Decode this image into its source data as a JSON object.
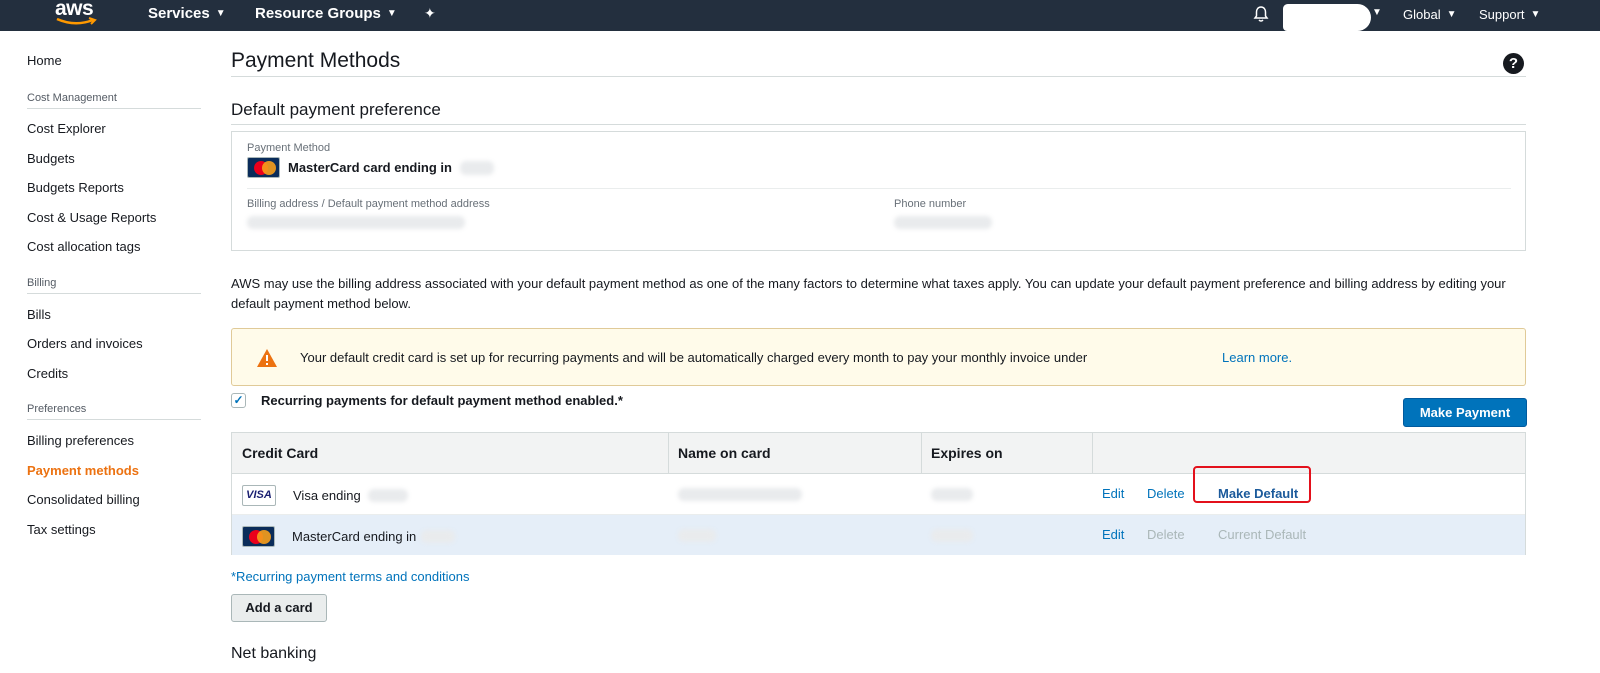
{
  "nav": {
    "logo": "aws",
    "services": "Services",
    "resource_groups": "Resource Groups",
    "region": "Global",
    "support": "Support"
  },
  "sidebar": {
    "home": "Home",
    "cost_management": {
      "heading": "Cost Management",
      "items": [
        "Cost Explorer",
        "Budgets",
        "Budgets Reports",
        "Cost & Usage Reports",
        "Cost allocation tags"
      ]
    },
    "billing": {
      "heading": "Billing",
      "items": [
        "Bills",
        "Orders and invoices",
        "Credits"
      ]
    },
    "preferences": {
      "heading": "Preferences",
      "items": [
        "Billing preferences",
        "Payment methods",
        "Consolidated billing",
        "Tax settings"
      ]
    },
    "active_item": "Payment methods"
  },
  "main": {
    "title": "Payment Methods",
    "default_section_title": "Default payment preference",
    "payment_method_label": "Payment Method",
    "payment_method_value": "MasterCard card ending in",
    "billing_address_label": "Billing address / Default payment method address",
    "phone_label": "Phone number",
    "tax_note": "AWS may use the billing address associated with your default payment method as one of the many factors to determine what taxes apply. You can update your default payment preference and billing address by editing your default payment method below.",
    "alert_text": "Your default credit card is set up for recurring payments and will be automatically charged every month to pay your monthly invoice under",
    "alert_link": "Learn more.",
    "recurring_label": "Recurring payments for default payment method enabled.*",
    "recurring_checked": true,
    "make_payment": "Make Payment",
    "terms_link": "*Recurring payment terms and conditions",
    "add_card": "Add a card",
    "net_banking": "Net banking"
  },
  "table": {
    "headers": [
      "Credit Card",
      "Name on card",
      "Expires on",
      ""
    ],
    "rows": [
      {
        "card_type": "VISA",
        "card_label": "Visa ending",
        "actions": [
          "Edit",
          "Delete",
          "Make Default"
        ],
        "selected": false
      },
      {
        "card_type": "MasterCard",
        "card_label": "MasterCard ending in",
        "actions": [
          "Edit",
          "Delete",
          "Current Default"
        ],
        "selected": true
      }
    ]
  },
  "colors": {
    "topbar": "#232f3e",
    "accent_orange": "#ec7211",
    "link_blue": "#0073bb",
    "primary_button": "#0073bb",
    "alert_bg": "#fffbea",
    "alert_border": "#e0ca98",
    "highlight_red": "#e3101b"
  },
  "icons": [
    "bell-icon",
    "pin-icon",
    "help-icon",
    "warning-icon",
    "mastercard-icon",
    "visa-icon",
    "chevron-down-icon",
    "checkmark-icon"
  ]
}
